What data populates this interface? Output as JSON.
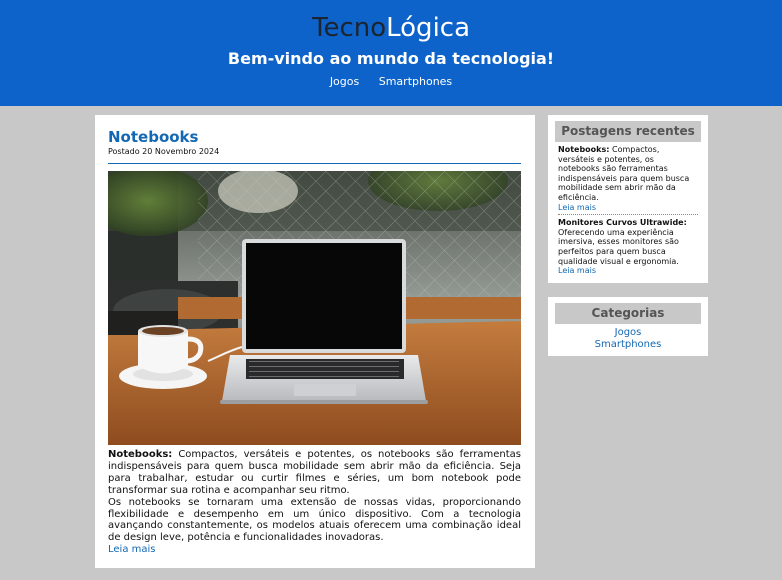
{
  "header": {
    "logo_part1": "Tecno",
    "logo_part2": "Lógica",
    "tagline": "Bem-vindo ao mundo da tecnologia!",
    "nav": [
      "Jogos",
      "Smartphones"
    ]
  },
  "post": {
    "title": "Notebooks",
    "date": "Postado 20 Novembro 2024",
    "image_icon": "laptop-and-coffee-photo",
    "lead_label": "Notebooks:",
    "lead_text": " Compactos, versáteis e potentes, os notebooks são ferramentas indispensáveis para quem busca mobilidade sem abrir mão da eficiência. Seja para trabalhar, estudar ou curtir filmes e séries, um bom notebook pode transformar sua rotina e acompanhar seu ritmo.",
    "paragraph2": "Os notebooks se tornaram uma extensão de nossas vidas, proporcionando flexibilidade e desempenho em um único dispositivo. Com a tecnologia avançando constantemente, os modelos atuais oferecem uma combinação ideal de design leve, potência e funcionalidades inovadoras.",
    "read_more": "Leia mais"
  },
  "sidebar": {
    "recent_title": "Postagens recentes",
    "recent": [
      {
        "label": "Notebooks:",
        "text": " Compactos, versáteis e potentes, os notebooks são ferramentas indispensáveis para quem busca mobilidade sem abrir mão da eficiência.",
        "link": "Leia mais"
      },
      {
        "label": "Monitores Curvos Ultrawide:",
        "text": " Oferecendo uma experiência imersiva, esses monitores são perfeitos para quem busca qualidade visual e ergonomia.",
        "link": "Leia mais"
      }
    ],
    "categories_title": "Categorias",
    "categories": [
      "Jogos",
      "Smartphones"
    ]
  },
  "colors": {
    "header_bg": "#0d63c9",
    "link": "#1268b3",
    "page_bg": "#c8c8c8"
  }
}
